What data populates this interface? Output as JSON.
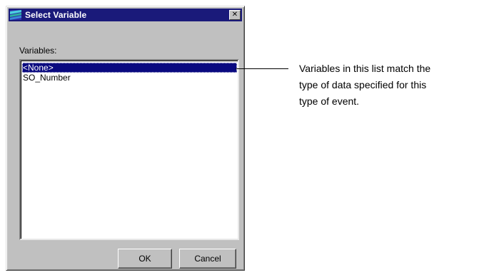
{
  "dialog": {
    "title": "Select Variable",
    "title_icon": "window-icon",
    "close_icon": "close-icon",
    "close_glyph": "✕",
    "variables_label": "Variables:",
    "variables": [
      {
        "label": "<None>",
        "selected": true
      },
      {
        "label": "SO_Number",
        "selected": false
      }
    ],
    "ok_label": "OK",
    "cancel_label": "Cancel"
  },
  "callout": {
    "lines": [
      "Variables in this list match the",
      "type of data specified for this",
      "type of event."
    ]
  },
  "colors": {
    "titlebar": "#1a1a7a",
    "selection": "#0a0a80",
    "dialog_face": "#c0c0c0"
  }
}
